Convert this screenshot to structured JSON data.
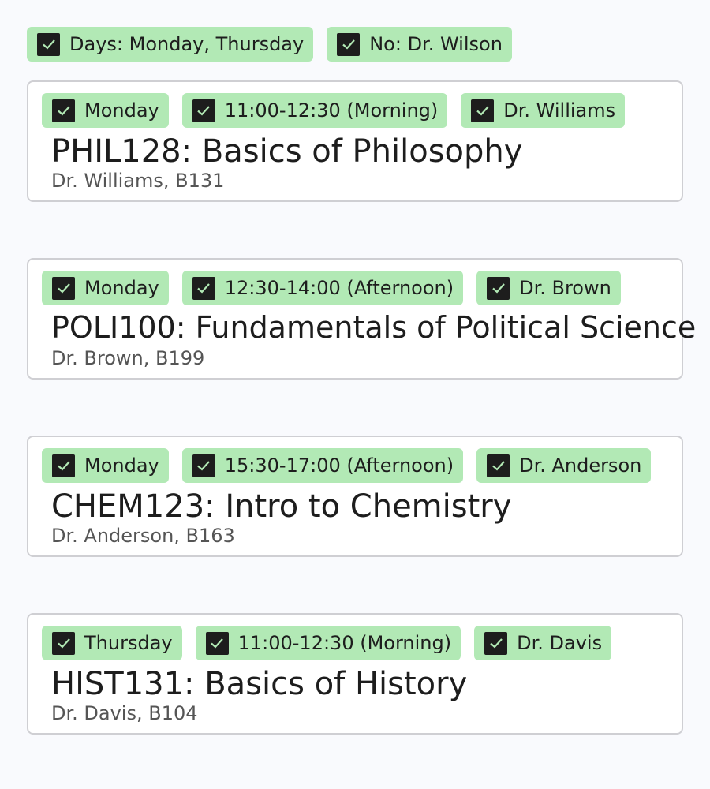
{
  "filters": [
    {
      "label": "Days: Monday, Thursday",
      "checked": true
    },
    {
      "label": "No: Dr. Wilson",
      "checked": true
    }
  ],
  "courses": [
    {
      "tags": [
        {
          "label": "Monday",
          "checked": true
        },
        {
          "label": "11:00-12:30 (Morning)",
          "checked": true
        },
        {
          "label": "Dr. Williams",
          "checked": true
        }
      ],
      "title": "PHIL128: Basics of Philosophy",
      "subtitle": "Dr. Williams, B131"
    },
    {
      "tags": [
        {
          "label": "Monday",
          "checked": true
        },
        {
          "label": "12:30-14:00 (Afternoon)",
          "checked": true
        },
        {
          "label": "Dr. Brown",
          "checked": true
        }
      ],
      "title": "POLI100: Fundamentals of Political Science",
      "subtitle": "Dr. Brown, B199"
    },
    {
      "tags": [
        {
          "label": "Monday",
          "checked": true
        },
        {
          "label": "15:30-17:00 (Afternoon)",
          "checked": true
        },
        {
          "label": "Dr. Anderson",
          "checked": true
        }
      ],
      "title": "CHEM123: Intro to Chemistry",
      "subtitle": "Dr. Anderson, B163"
    },
    {
      "tags": [
        {
          "label": "Thursday",
          "checked": true
        },
        {
          "label": "11:00-12:30 (Morning)",
          "checked": true
        },
        {
          "label": "Dr. Davis",
          "checked": true
        }
      ],
      "title": "HIST131: Basics of History",
      "subtitle": "Dr. Davis, B104"
    }
  ],
  "colors": {
    "chip_bg": "#b2e9b5",
    "checkbox": "#1d1d1d",
    "card_border": "#cfcfd3",
    "page_bg": "#f9fafd"
  }
}
